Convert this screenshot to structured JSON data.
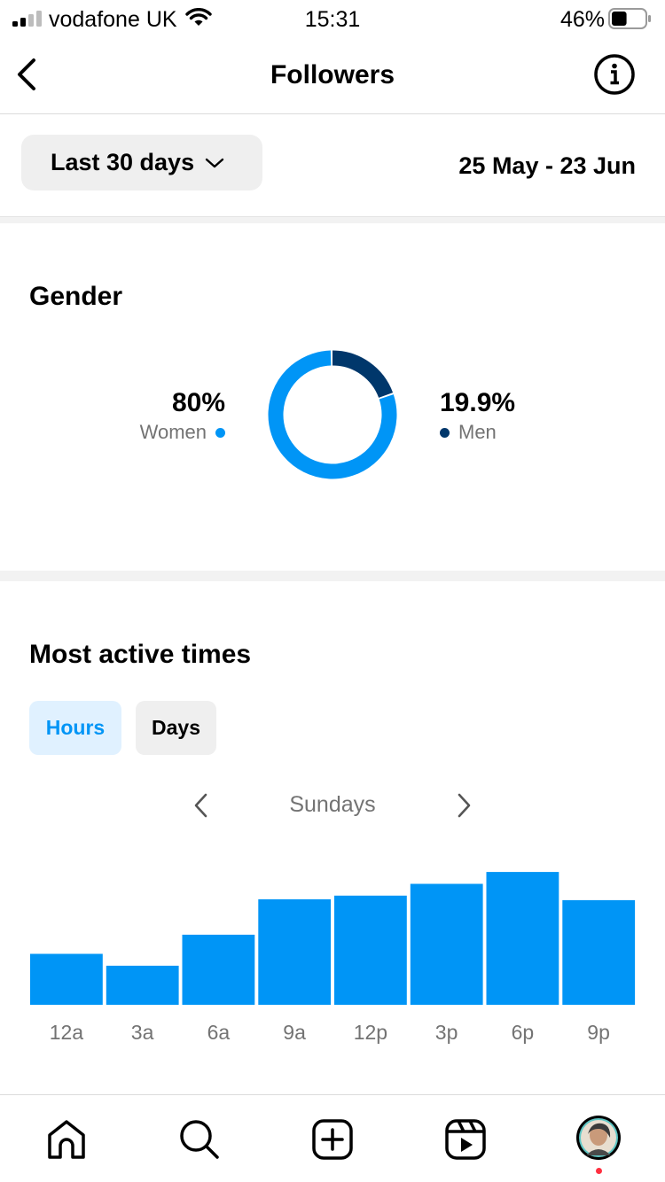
{
  "status_bar": {
    "carrier": "vodafone UK",
    "time": "15:31",
    "battery_percent": "46%",
    "battery_level": 0.46
  },
  "nav": {
    "title": "Followers",
    "back_icon": "chevron-left-icon",
    "info_icon": "info-icon"
  },
  "filter": {
    "range_label": "Last 30 days",
    "date_range": "25 May - 23 Jun"
  },
  "gender": {
    "title": "Gender",
    "women": {
      "value": "80%",
      "label": "Women",
      "color": "#0095f6",
      "fraction": 0.8
    },
    "men": {
      "value": "19.9%",
      "label": "Men",
      "color": "#00376b",
      "fraction": 0.199
    }
  },
  "active_times": {
    "title": "Most active times",
    "tabs": [
      {
        "label": "Hours",
        "selected": true
      },
      {
        "label": "Days",
        "selected": false
      }
    ],
    "day_label": "Sundays"
  },
  "chart_data": {
    "type": "bar",
    "categories": [
      "12a",
      "3a",
      "6a",
      "9a",
      "12p",
      "3p",
      "6p",
      "9p"
    ],
    "values": [
      56,
      43,
      77,
      116,
      120,
      133,
      146,
      115
    ],
    "color": "#0095f6",
    "ylim": [
      0,
      150
    ],
    "grid": false
  },
  "tab_bar": {
    "items": [
      "home-icon",
      "search-icon",
      "create-icon",
      "reels-icon",
      "profile-avatar"
    ],
    "notification_color": "#ff3040"
  }
}
